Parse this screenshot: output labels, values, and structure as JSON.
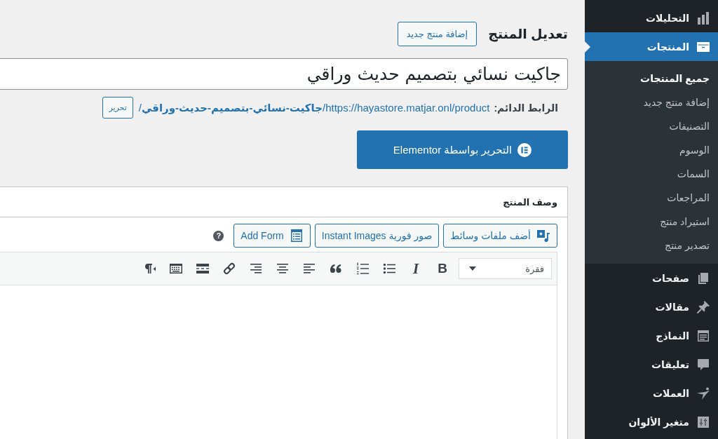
{
  "sidebar": {
    "items": [
      {
        "label": "التحليلات",
        "selected": false
      },
      {
        "label": "المنتجات",
        "selected": true,
        "children": [
          {
            "label": "جميع المنتجات",
            "selected": true
          },
          {
            "label": "إضافة منتج جديد",
            "selected": false
          },
          {
            "label": "التصنيفات",
            "selected": false
          },
          {
            "label": "الوسوم",
            "selected": false
          },
          {
            "label": "السمات",
            "selected": false
          },
          {
            "label": "المراجعات",
            "selected": false
          },
          {
            "label": "استيراد منتج",
            "selected": false
          },
          {
            "label": "تصدير منتج",
            "selected": false
          }
        ]
      },
      {
        "label": "صفحات",
        "selected": false
      },
      {
        "label": "مقالات",
        "selected": false
      },
      {
        "label": "النماذج",
        "selected": false
      },
      {
        "label": "تعليقات",
        "selected": false
      },
      {
        "label": "العملات",
        "selected": false
      },
      {
        "label": "متغير الألوان",
        "selected": false
      }
    ]
  },
  "page": {
    "title": "تعديل المنتج",
    "add_new_button": "إضافة منتج جديد"
  },
  "post_title": {
    "value": "جاكيت نسائي بتصميم حديث وراقي"
  },
  "permalink": {
    "label": "الرابط الدائم:",
    "url": "https://hayastore.matjar.onl/product/**جاكيت-نسائي-بتصميم-حديث-وراقي**/",
    "edit_button": "تحرير"
  },
  "elementor_button": "التحرير بواسطة Elementor",
  "description_box": {
    "title": "وصف المنتج",
    "media_buttons": [
      "أضف ملفات وسائط",
      "صور فورية Instant Images",
      "Add Form"
    ],
    "help": "?",
    "toolbar": {
      "format": "فقرة",
      "text_buttons": [
        "B",
        "I"
      ]
    }
  }
}
